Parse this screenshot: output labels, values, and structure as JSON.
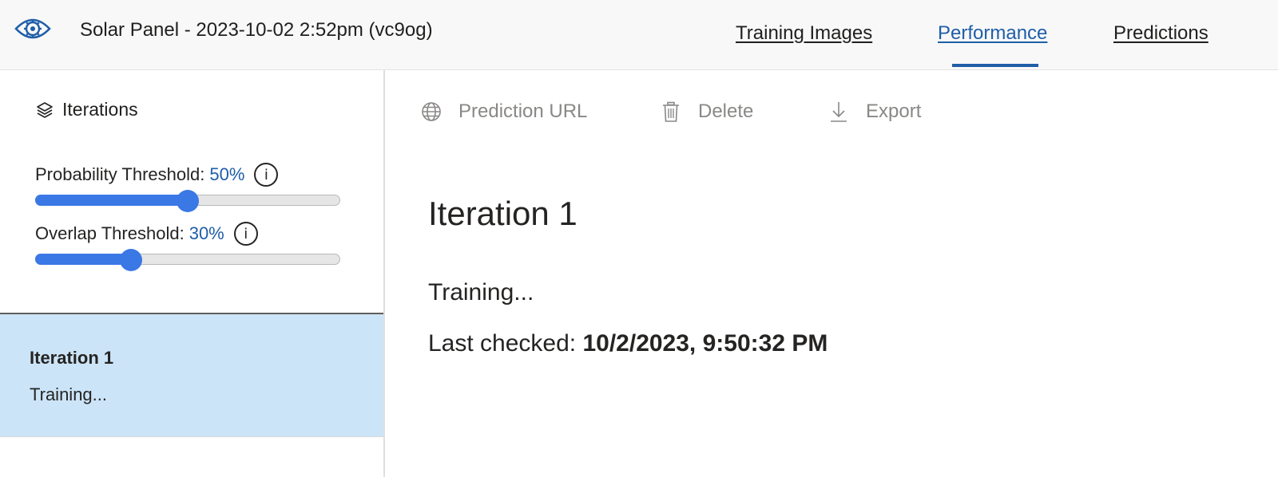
{
  "header": {
    "logo_icon": "eye-gear-icon",
    "project_title": "Solar Panel - 2023-10-02 2:52pm (vc9og)",
    "tabs": [
      {
        "label": "Training Images",
        "active": false
      },
      {
        "label": "Performance",
        "active": true
      },
      {
        "label": "Predictions",
        "active": false
      }
    ]
  },
  "sidebar": {
    "iterations_icon": "layers-icon",
    "iterations_label": "Iterations",
    "probability": {
      "label": "Probability Threshold:",
      "value_text": "50%",
      "value": 50
    },
    "overlap": {
      "label": "Overlap Threshold:",
      "value_text": "30%",
      "value": 30
    },
    "iteration_items": [
      {
        "name": "Iteration 1",
        "status": "Training...",
        "selected": true
      }
    ]
  },
  "toolbar": {
    "prediction_url": {
      "label": "Prediction URL",
      "icon": "globe-icon"
    },
    "delete": {
      "label": "Delete",
      "icon": "trash-icon"
    },
    "export": {
      "label": "Export",
      "icon": "download-icon"
    }
  },
  "main": {
    "iteration_title": "Iteration 1",
    "status": "Training...",
    "last_checked_label": "Last checked:",
    "last_checked_value": "10/2/2023, 9:50:32 PM"
  },
  "colors": {
    "accent": "#1f5ea8",
    "slider": "#3a78e6",
    "selected_bg": "#cce4f7",
    "header_bg": "#f8f8f8",
    "disabled_text": "#8a8886"
  }
}
